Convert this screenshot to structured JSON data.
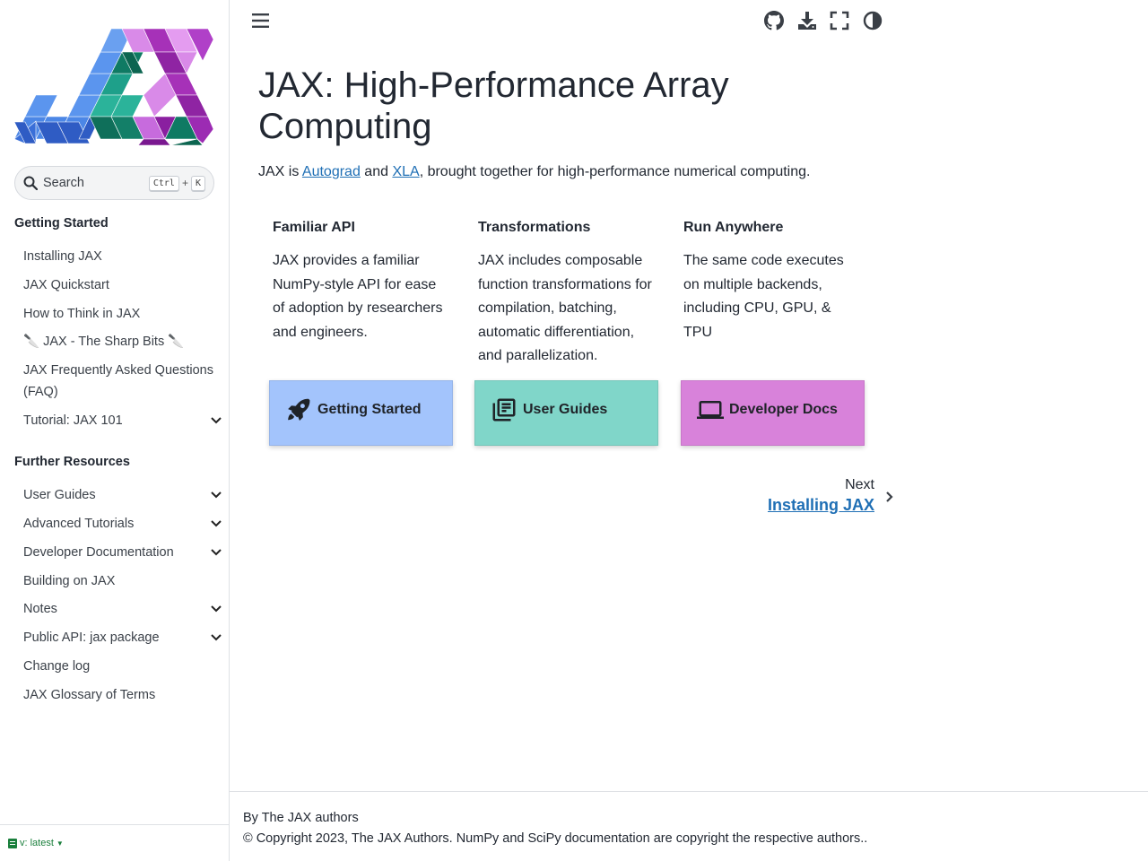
{
  "sidebar": {
    "search": {
      "placeholder": "Search",
      "key1": "Ctrl",
      "plus": "+",
      "key2": "K"
    },
    "sections": [
      {
        "caption": "Getting Started",
        "items": [
          {
            "label": "Installing JAX"
          },
          {
            "label": "JAX Quickstart"
          },
          {
            "label": "How to Think in JAX"
          },
          {
            "label": "🔪 JAX - The Sharp Bits 🔪"
          },
          {
            "label": "JAX Frequently Asked Questions (FAQ)"
          },
          {
            "label": "Tutorial: JAX 101",
            "expandable": true
          }
        ]
      },
      {
        "caption": "Further Resources",
        "items": [
          {
            "label": "User Guides",
            "expandable": true
          },
          {
            "label": "Advanced Tutorials",
            "expandable": true
          },
          {
            "label": "Developer Documentation",
            "expandable": true
          },
          {
            "label": "Building on JAX"
          },
          {
            "label": "Notes",
            "expandable": true
          },
          {
            "label": "Public API: jax package",
            "expandable": true
          },
          {
            "label": "Change log"
          },
          {
            "label": "JAX Glossary of Terms"
          }
        ]
      }
    ],
    "version": "v: latest"
  },
  "header": {
    "icons": [
      "menu-icon",
      "github-icon",
      "download-icon",
      "fullscreen-icon",
      "theme-toggle-icon"
    ]
  },
  "main": {
    "title": "JAX: High-Performance Array Computing",
    "intro": {
      "prefix": "JAX is ",
      "link1": "Autograd",
      "mid": " and ",
      "link2": "XLA",
      "suffix": ", brought together for high-performance numerical computing."
    },
    "cards": [
      {
        "title": "Familiar API",
        "body": "JAX provides a familiar NumPy-style API for ease of adoption by researchers and engineers."
      },
      {
        "title": "Transformations",
        "body": "JAX includes composable function transformations for compilation, batching, automatic differentiation, and parallelization."
      },
      {
        "title": "Run Anywhere",
        "body": "The same code executes on multiple backends, including CPU, GPU, & TPU"
      }
    ],
    "buttons": [
      {
        "label": "Getting Started",
        "icon": "rocket-icon",
        "color": "#a3c4fc"
      },
      {
        "label": "User Guides",
        "icon": "library-books-icon",
        "color": "#80d6c9"
      },
      {
        "label": "Developer Docs",
        "icon": "laptop-icon",
        "color": "#d882da"
      }
    ],
    "next": {
      "label": "Next",
      "link": "Installing JAX"
    }
  },
  "footer": {
    "authors": "By The JAX authors",
    "copyright": "© Copyright 2023, The JAX Authors. NumPy and SciPy documentation are copyright the respective authors.."
  },
  "colors": {
    "link": "#1f6fb5",
    "version": "#1a7f3c"
  }
}
